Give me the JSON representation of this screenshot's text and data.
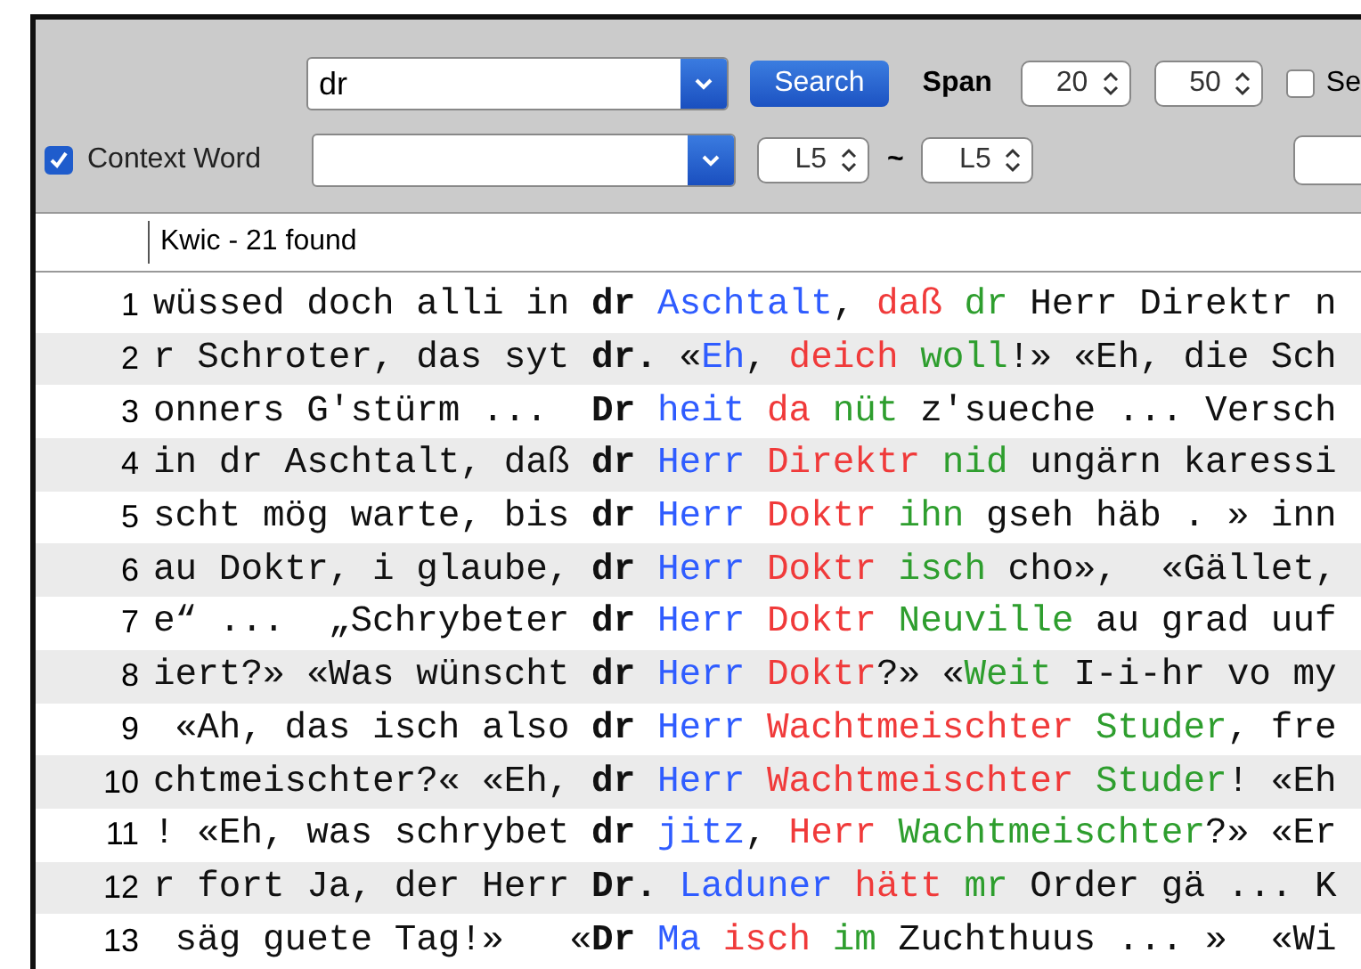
{
  "toolbar": {
    "search_field": {
      "value": "dr"
    },
    "search_button": "Search",
    "span_label": "Span",
    "span_from": "20",
    "span_to": "50",
    "option_checkbox": {
      "label": "Se",
      "checked": false
    },
    "context_checkbox": {
      "label": "Context Word",
      "checked": true
    },
    "range_from": "L5",
    "range_separator": "~",
    "range_to": "L5"
  },
  "results": {
    "header": "Kwic - 21 found",
    "rows": [
      {
        "number": "1",
        "segments": [
          {
            "kind": "plain",
            "text": "wüssed doch alli in "
          },
          {
            "kind": "key",
            "text": "dr"
          },
          {
            "kind": "c1",
            "text": " Aschtalt"
          },
          {
            "kind": "plain",
            "text": ", "
          },
          {
            "kind": "c2",
            "text": "daß"
          },
          {
            "kind": "c3",
            "text": " dr"
          },
          {
            "kind": "plain",
            "text": " Herr Direktr n"
          }
        ]
      },
      {
        "number": "2",
        "segments": [
          {
            "kind": "plain",
            "text": "r Schroter, das syt "
          },
          {
            "kind": "key",
            "text": "dr."
          },
          {
            "kind": "plain",
            "text": " «"
          },
          {
            "kind": "c1",
            "text": "Eh"
          },
          {
            "kind": "plain",
            "text": ", "
          },
          {
            "kind": "c2",
            "text": "deich"
          },
          {
            "kind": "c3",
            "text": " woll"
          },
          {
            "kind": "plain",
            "text": "!» «Eh, die Sch"
          }
        ]
      },
      {
        "number": "3",
        "segments": [
          {
            "kind": "plain",
            "text": "onners G'stürm ...  "
          },
          {
            "kind": "key",
            "text": "Dr"
          },
          {
            "kind": "c1",
            "text": " heit"
          },
          {
            "kind": "c2",
            "text": " da"
          },
          {
            "kind": "c3",
            "text": " nüt"
          },
          {
            "kind": "plain",
            "text": " z'sueche ... Versch"
          }
        ]
      },
      {
        "number": "4",
        "segments": [
          {
            "kind": "plain",
            "text": "in dr Aschtalt, daß "
          },
          {
            "kind": "key",
            "text": "dr"
          },
          {
            "kind": "c1",
            "text": " Herr"
          },
          {
            "kind": "c2",
            "text": " Direktr"
          },
          {
            "kind": "c3",
            "text": " nid"
          },
          {
            "kind": "plain",
            "text": " ungärn karessi"
          }
        ]
      },
      {
        "number": "5",
        "segments": [
          {
            "kind": "plain",
            "text": "scht mög warte, bis "
          },
          {
            "kind": "key",
            "text": "dr"
          },
          {
            "kind": "c1",
            "text": " Herr"
          },
          {
            "kind": "c2",
            "text": " Doktr"
          },
          {
            "kind": "c3",
            "text": " ihn"
          },
          {
            "kind": "plain",
            "text": " gseh häb . » inn"
          }
        ]
      },
      {
        "number": "6",
        "segments": [
          {
            "kind": "plain",
            "text": "au Doktr, i glaube, "
          },
          {
            "kind": "key",
            "text": "dr"
          },
          {
            "kind": "c1",
            "text": " Herr"
          },
          {
            "kind": "c2",
            "text": " Doktr"
          },
          {
            "kind": "c3",
            "text": " isch"
          },
          {
            "kind": "plain",
            "text": " cho»,  «Gället,"
          }
        ]
      },
      {
        "number": "7",
        "segments": [
          {
            "kind": "plain",
            "text": "e“ ...  „Schrybeter "
          },
          {
            "kind": "key",
            "text": "dr"
          },
          {
            "kind": "c1",
            "text": " Herr"
          },
          {
            "kind": "c2",
            "text": " Doktr"
          },
          {
            "kind": "c3",
            "text": " Neuville"
          },
          {
            "kind": "plain",
            "text": " au grad uuf"
          }
        ]
      },
      {
        "number": "8",
        "segments": [
          {
            "kind": "plain",
            "text": "iert?» «Was wünscht "
          },
          {
            "kind": "key",
            "text": "dr"
          },
          {
            "kind": "c1",
            "text": " Herr"
          },
          {
            "kind": "c2",
            "text": " Doktr"
          },
          {
            "kind": "plain",
            "text": "?» «"
          },
          {
            "kind": "c3",
            "text": "Weit"
          },
          {
            "kind": "plain",
            "text": " I-i-hr vo my"
          }
        ]
      },
      {
        "number": "9",
        "segments": [
          {
            "kind": "plain",
            "text": " «Ah, das isch also "
          },
          {
            "kind": "key",
            "text": "dr"
          },
          {
            "kind": "c1",
            "text": " Herr"
          },
          {
            "kind": "c2",
            "text": " Wachtmeischter"
          },
          {
            "kind": "c3",
            "text": " Studer"
          },
          {
            "kind": "plain",
            "text": ", fre"
          }
        ]
      },
      {
        "number": "10",
        "segments": [
          {
            "kind": "plain",
            "text": "chtmeischter?« «Eh, "
          },
          {
            "kind": "key",
            "text": "dr"
          },
          {
            "kind": "c1",
            "text": " Herr"
          },
          {
            "kind": "c2",
            "text": " Wachtmeischter"
          },
          {
            "kind": "c3",
            "text": " Studer"
          },
          {
            "kind": "plain",
            "text": "! «Eh"
          }
        ]
      },
      {
        "number": "11",
        "segments": [
          {
            "kind": "plain",
            "text": "! «Eh, was schrybet "
          },
          {
            "kind": "key",
            "text": "dr"
          },
          {
            "kind": "c1",
            "text": " jitz"
          },
          {
            "kind": "plain",
            "text": ", "
          },
          {
            "kind": "c2",
            "text": "Herr"
          },
          {
            "kind": "c3",
            "text": " Wachtmeischter"
          },
          {
            "kind": "plain",
            "text": "?» «Er"
          }
        ]
      },
      {
        "number": "12",
        "segments": [
          {
            "kind": "plain",
            "text": "r fort Ja, der Herr "
          },
          {
            "kind": "key",
            "text": "Dr."
          },
          {
            "kind": "c1",
            "text": " Laduner"
          },
          {
            "kind": "c2",
            "text": " hätt"
          },
          {
            "kind": "c3",
            "text": " mr"
          },
          {
            "kind": "plain",
            "text": " Order gä ... K"
          }
        ]
      },
      {
        "number": "13",
        "segments": [
          {
            "kind": "plain",
            "text": " säg guete Tag!»   «"
          },
          {
            "kind": "key",
            "text": "Dr"
          },
          {
            "kind": "c1",
            "text": " Ma"
          },
          {
            "kind": "c2",
            "text": " isch"
          },
          {
            "kind": "c3",
            "text": " im"
          },
          {
            "kind": "plain",
            "text": " Zuchthuus ... »  «Wi"
          }
        ]
      }
    ]
  }
}
